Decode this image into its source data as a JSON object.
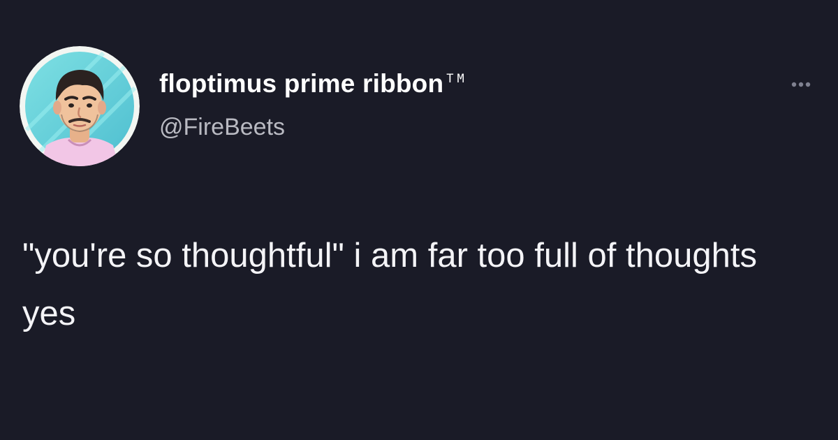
{
  "tweet": {
    "author": {
      "display_name": "floptimus prime ribbon",
      "name_suffix": "TM",
      "handle": "@FireBeets",
      "avatar_icon": "cartoon-avatar"
    },
    "more_icon": "ellipsis-icon",
    "text": "\"you're so thoughtful\" i am far too full of thoughts yes"
  },
  "colors": {
    "background": "#1a1b27",
    "primary_text": "#f4f4f7",
    "secondary_text": "#b9bac2",
    "avatar_background": "#6fd1d9"
  }
}
